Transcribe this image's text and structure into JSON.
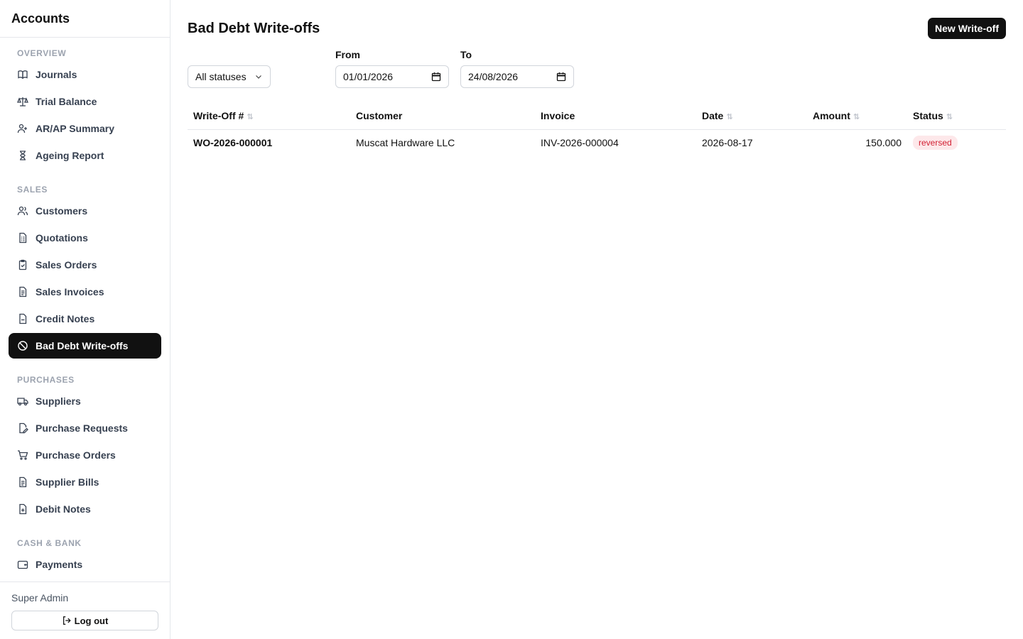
{
  "app": {
    "title": "Accounts"
  },
  "sidebar": {
    "sections": [
      {
        "label": "OVERVIEW",
        "items": [
          {
            "label": "Journals",
            "icon": "book-icon"
          },
          {
            "label": "Trial Balance",
            "icon": "scale-icon"
          },
          {
            "label": "AR/AP Summary",
            "icon": "user-icon"
          },
          {
            "label": "Ageing Report",
            "icon": "hourglass-icon"
          }
        ]
      },
      {
        "label": "SALES",
        "items": [
          {
            "label": "Customers",
            "icon": "users-icon"
          },
          {
            "label": "Quotations",
            "icon": "document-list-icon"
          },
          {
            "label": "Sales Orders",
            "icon": "clipboard-check-icon"
          },
          {
            "label": "Sales Invoices",
            "icon": "document-text-icon"
          },
          {
            "label": "Credit Notes",
            "icon": "document-minus-icon"
          },
          {
            "label": "Bad Debt Write-offs",
            "icon": "ban-icon",
            "active": true
          }
        ]
      },
      {
        "label": "PURCHASES",
        "items": [
          {
            "label": "Suppliers",
            "icon": "truck-icon"
          },
          {
            "label": "Purchase Requests",
            "icon": "document-edit-icon"
          },
          {
            "label": "Purchase Orders",
            "icon": "cart-icon"
          },
          {
            "label": "Supplier Bills",
            "icon": "document-text-icon"
          },
          {
            "label": "Debit Notes",
            "icon": "document-plus-icon"
          }
        ]
      },
      {
        "label": "CASH & BANK",
        "items": [
          {
            "label": "Payments",
            "icon": "wallet-icon"
          }
        ]
      }
    ],
    "footer": {
      "user": "Super Admin",
      "logout_label": "Log out"
    }
  },
  "main": {
    "title": "Bad Debt Write-offs",
    "new_button": "New Write-off",
    "filters": {
      "status": "All statuses",
      "from_label": "From",
      "from_value": "01/01/2026",
      "to_label": "To",
      "to_value": "24/08/2026"
    },
    "table": {
      "columns": [
        "Write-Off #",
        "Customer",
        "Invoice",
        "Date",
        "Amount",
        "Status"
      ],
      "rows": [
        {
          "id": "WO-2026-000001",
          "customer": "Muscat Hardware LLC",
          "invoice": "INV-2026-000004",
          "date": "2026-08-17",
          "amount": "150.000",
          "status": "reversed"
        }
      ]
    }
  },
  "colors": {
    "accent": "#111111",
    "status_reversed_bg": "#fde8ea",
    "status_reversed_fg": "#d21f32"
  }
}
